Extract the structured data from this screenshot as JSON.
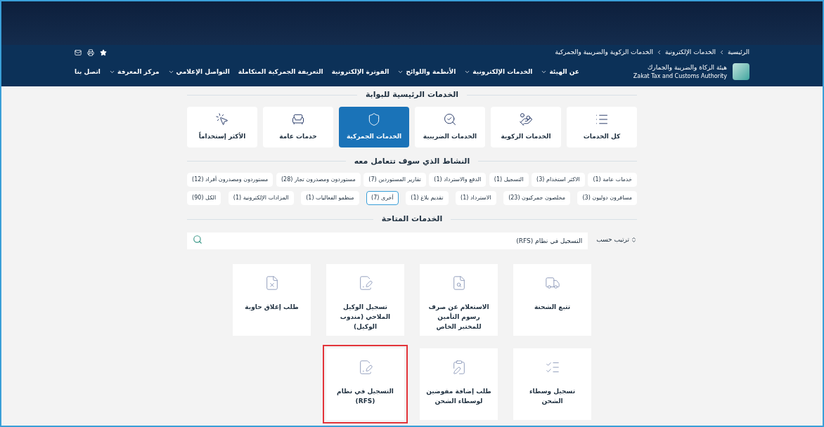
{
  "breadcrumb": [
    "الرئيسية",
    "الخدمات الإلكترونية",
    "الخدمات الزكوية والضريبية والجمركية"
  ],
  "logo": {
    "name_ar": "هيئة الزكاة والضريبة والجمارك",
    "name_en": "Zakat Tax and Customs Authority"
  },
  "nav": [
    {
      "label": "عن الهيئة",
      "dropdown": true
    },
    {
      "label": "الخدمات الإلكترونية",
      "dropdown": true
    },
    {
      "label": "الأنظمة واللوائح",
      "dropdown": true
    },
    {
      "label": "الفوترة الإلكترونية",
      "dropdown": false
    },
    {
      "label": "التعريفة الجمركية المتكاملة",
      "dropdown": false
    },
    {
      "label": "التواصل الإعلامي",
      "dropdown": true
    },
    {
      "label": "مركز المعرفة",
      "dropdown": true
    },
    {
      "label": "اتصل بنا",
      "dropdown": false
    }
  ],
  "main_services": {
    "title": "الخدمات الرئيسية للبوابة",
    "items": [
      {
        "label": "كل الخدمات",
        "selected": false
      },
      {
        "label": "الخدمات الزكوية",
        "selected": false
      },
      {
        "label": "الخدمات الضريبية",
        "selected": false
      },
      {
        "label": "الخدمات الجمركية",
        "selected": true
      },
      {
        "label": "خدمات عامة",
        "selected": false
      },
      {
        "label": "الأكثر إستخداماً",
        "selected": false
      }
    ]
  },
  "activity": {
    "title": "النشاط الذي سوف تتعامل معه",
    "first_line": [
      {
        "label": "خدمات عامة (1)",
        "selected": false
      },
      {
        "label": "الاكثر استخدام (3)",
        "selected": false
      },
      {
        "label": "التسجيل (1)",
        "selected": false
      },
      {
        "label": "الدفع والاسترداد (1)",
        "selected": false
      },
      {
        "label": "تقارير المستوردين (7)",
        "selected": false
      },
      {
        "label": "مستوردون ومصدرون تجار (28)",
        "selected": false
      },
      {
        "label": "مستوردون ومصدرون أفراد (12)",
        "selected": false
      }
    ],
    "second_line": [
      {
        "label": "مسافرون دوليون (3)",
        "selected": false
      },
      {
        "label": "مخلصون جمركيون (23)",
        "selected": false
      },
      {
        "label": "الاسترداد (1)",
        "selected": false
      },
      {
        "label": "تقديم بلاغ (1)",
        "selected": false
      },
      {
        "label": "أخرى (7)",
        "selected": true
      },
      {
        "label": "منظمو الفعاليات (1)",
        "selected": false
      },
      {
        "label": "المزادات الإلكترونية (1)",
        "selected": false
      },
      {
        "label": "الكل (90)",
        "selected": false
      }
    ]
  },
  "available_services": {
    "title": "الخدمات المتاحة",
    "sort_label": "ترتيب حسب",
    "search_value": "التسجيل في نظام (RFS)",
    "cards": [
      {
        "title": "تتبع الشحنة",
        "highlighted": false
      },
      {
        "title": "الاستعلام عن صرف رسوم التأمين للمختبر الخاص",
        "highlighted": false
      },
      {
        "title": "تسجيل الوكيل الملاحي (مندوب الوكيل)",
        "highlighted": false
      },
      {
        "title": "طلب إغلاق حاوية",
        "highlighted": false
      },
      {
        "title": "تسجيل وسطاء الشحن",
        "highlighted": false
      },
      {
        "title": "طلب إضافة مفوضين لوسطاء الشحن",
        "highlighted": false
      },
      {
        "title": "التسجيل في نظام (RFS)",
        "highlighted": true
      }
    ]
  }
}
